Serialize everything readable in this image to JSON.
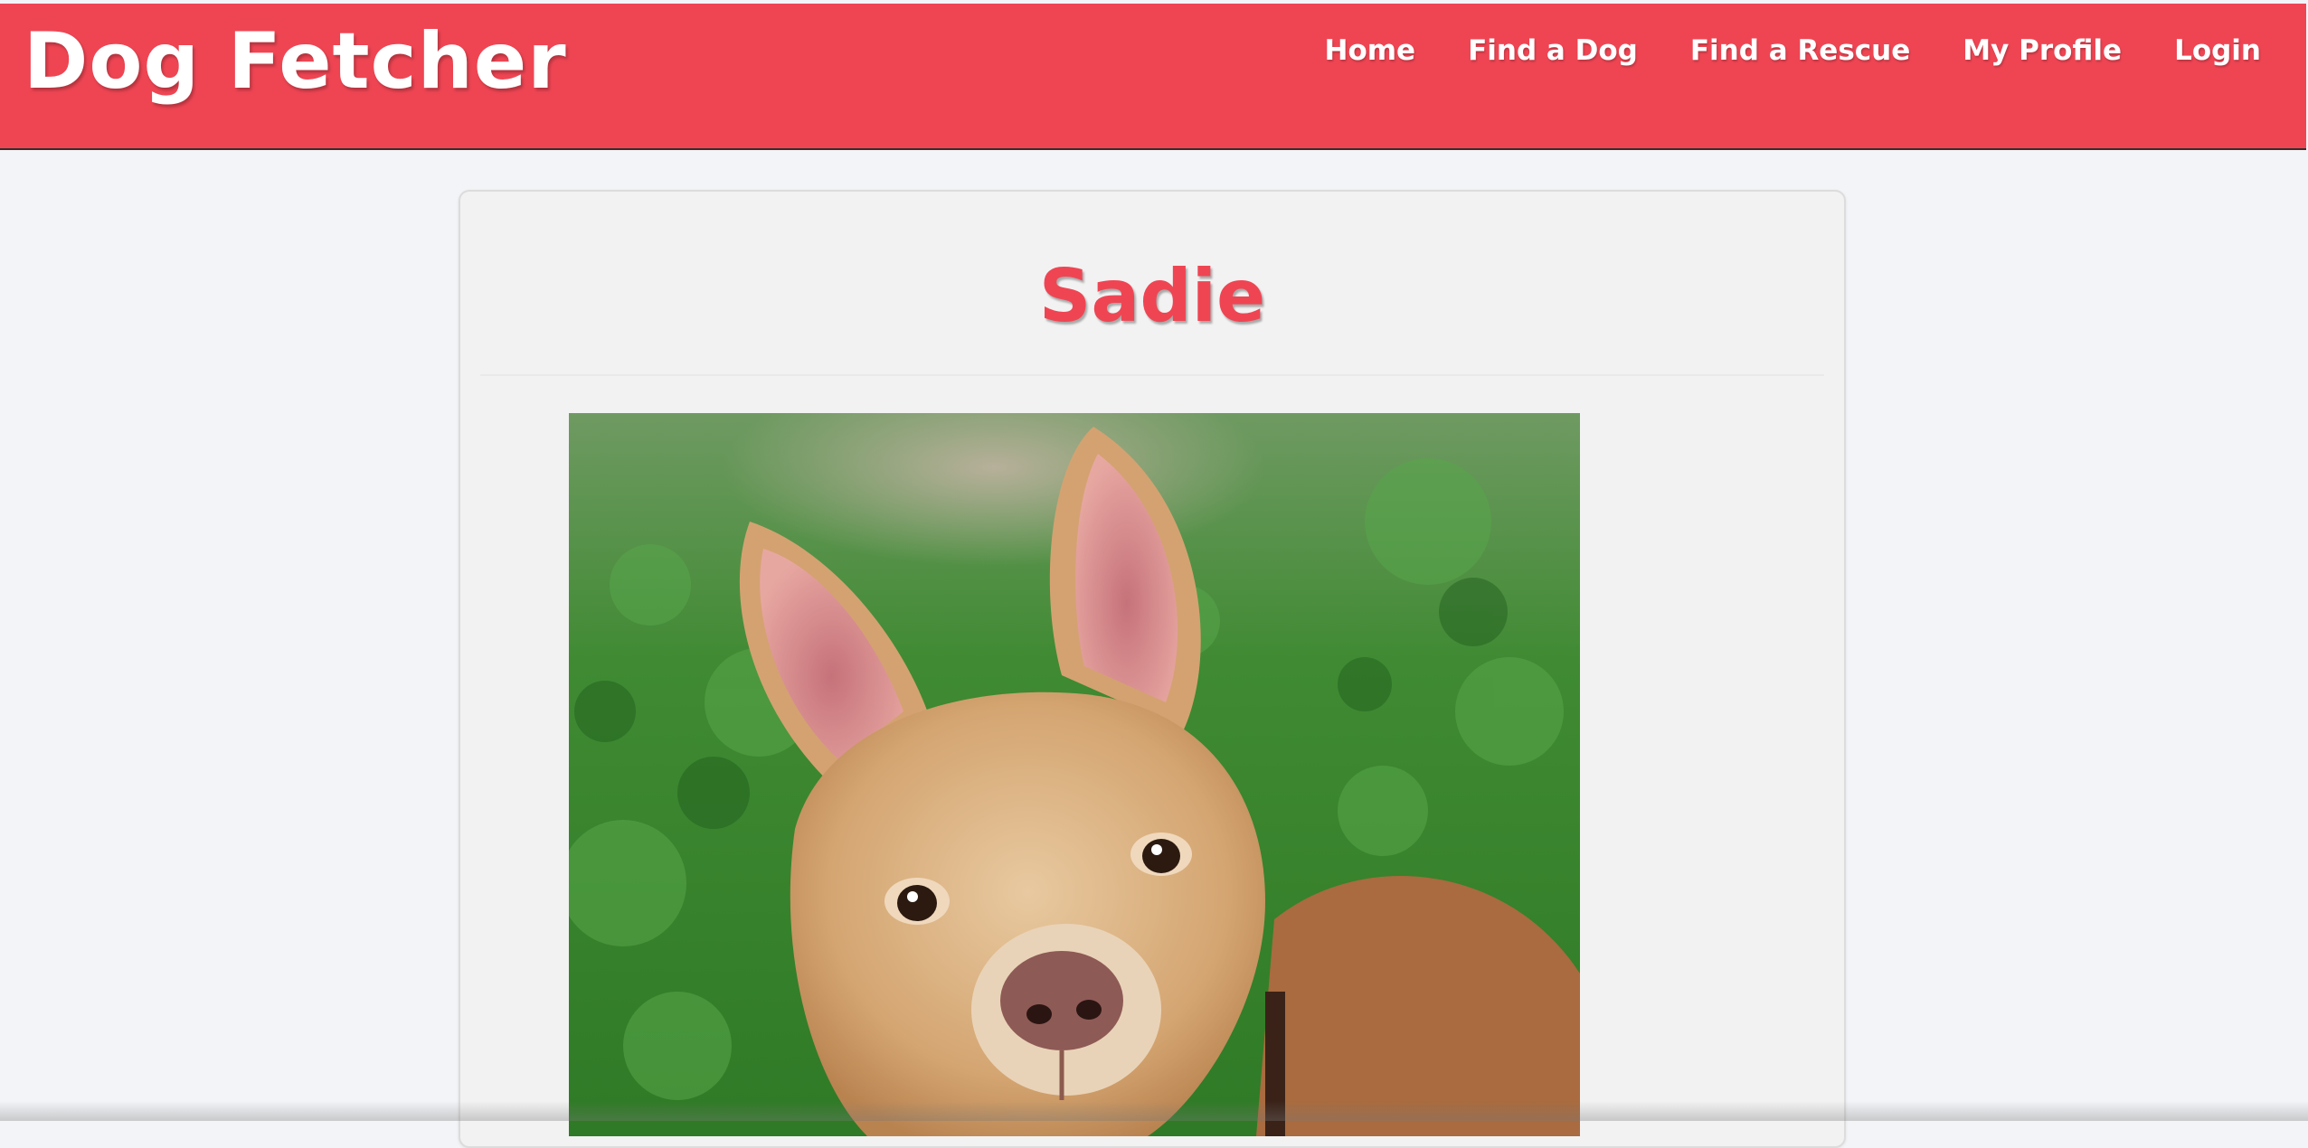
{
  "header": {
    "brand": "Dog Fetcher",
    "nav": [
      {
        "label": "Home"
      },
      {
        "label": "Find a Dog"
      },
      {
        "label": "Find a Rescue"
      },
      {
        "label": "My Profile"
      },
      {
        "label": "Login"
      }
    ]
  },
  "dog": {
    "name": "Sadie",
    "photo_alt": "Sadie"
  },
  "colors": {
    "brand": "#ef4553",
    "page_bg": "#f3f4f7",
    "card_bg": "#f2f2f2"
  }
}
